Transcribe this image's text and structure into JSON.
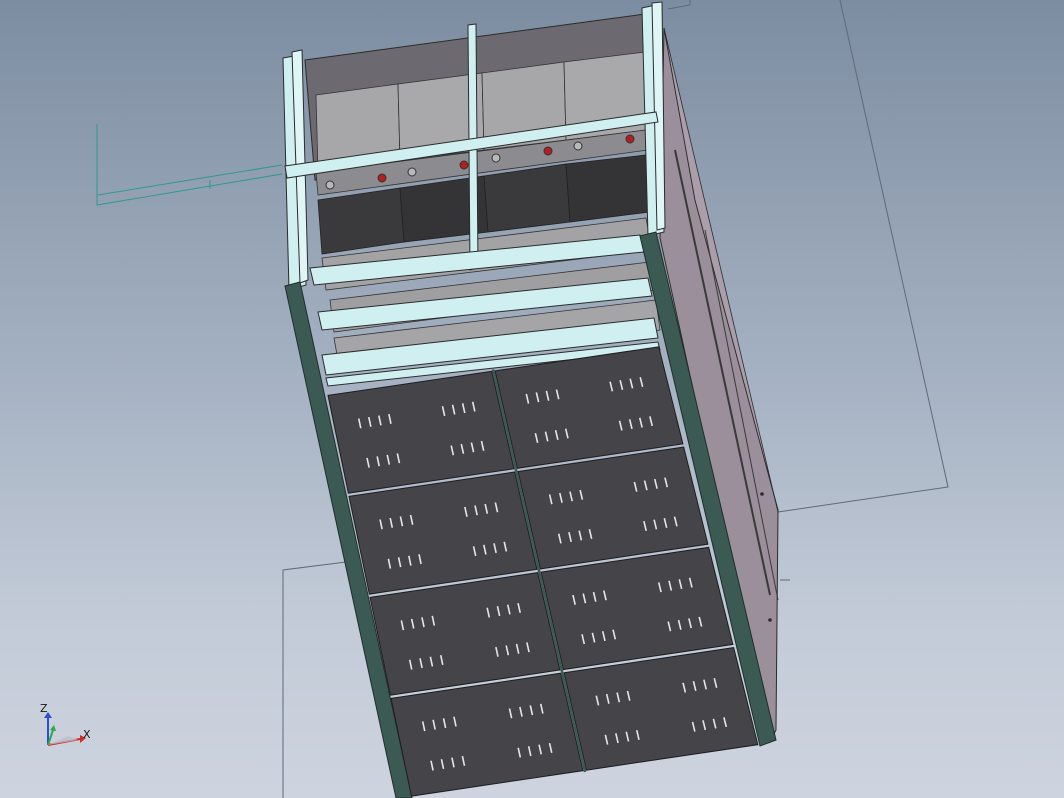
{
  "viewport": {
    "background_top": "#7d8da1",
    "background_bottom": "#cdd4df"
  },
  "model": {
    "frame_color": "#cfeff0",
    "panel_color": "#454449",
    "side_color": "#9a8f9a",
    "post_color": "#3c5a54",
    "battery_color": "#a7a7a9",
    "battery_dark_color": "#3a393c",
    "terminal_color": "#b51e1e"
  },
  "triad": {
    "z_label": "Z",
    "x_label": "X",
    "x_color": "#d12a2a",
    "y_color": "#2aa84a",
    "z_color": "#2a4fd1"
  }
}
